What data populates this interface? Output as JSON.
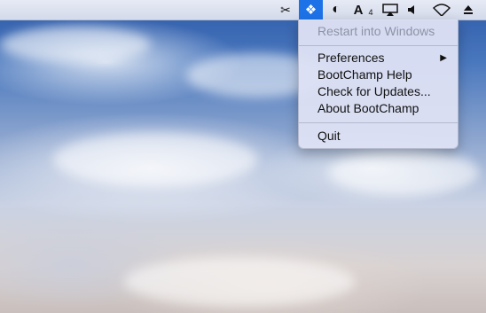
{
  "menubar": {
    "icons": [
      {
        "name": "scissors-icon",
        "glyph": "✂"
      },
      {
        "name": "bootchamp-icon",
        "glyph": "❖"
      },
      {
        "name": "yin-yang-icon",
        "glyph": "◐"
      },
      {
        "name": "adobe-icon",
        "glyph": "A"
      },
      {
        "name": "airplay-icon",
        "glyph": "▭"
      },
      {
        "name": "volume-icon",
        "glyph": "◀"
      },
      {
        "name": "wifi-icon",
        "glyph": "◠"
      },
      {
        "name": "eject-icon",
        "glyph": "⏏"
      }
    ],
    "adobe_badge": "4"
  },
  "menu": {
    "restart": "Restart into Windows",
    "preferences": "Preferences",
    "preferences_arrow": "▶",
    "help": "BootChamp Help",
    "updates": "Check for Updates...",
    "about": "About BootChamp",
    "quit": "Quit"
  }
}
